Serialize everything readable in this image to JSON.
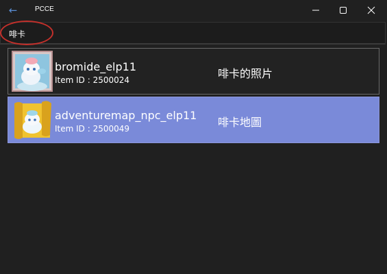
{
  "window": {
    "title": "PCCE",
    "back_icon": "arrow-left-icon",
    "accent": "#5b8fd6"
  },
  "search": {
    "query": "啡卡"
  },
  "items": [
    {
      "name": "bromide_elp11",
      "id_text": "Item ID : 2500024",
      "description": "啡卡的照片",
      "icon": "bromide-photo-icon",
      "selected": false
    },
    {
      "name": "adventuremap_npc_elp11",
      "id_text": "Item ID : 2500049",
      "description": "啡卡地圖",
      "icon": "adventure-map-icon",
      "selected": true
    }
  ],
  "colors": {
    "background": "#202020",
    "selected_row": "#7a8ad9",
    "highlight_ellipse": "#c4302b"
  }
}
